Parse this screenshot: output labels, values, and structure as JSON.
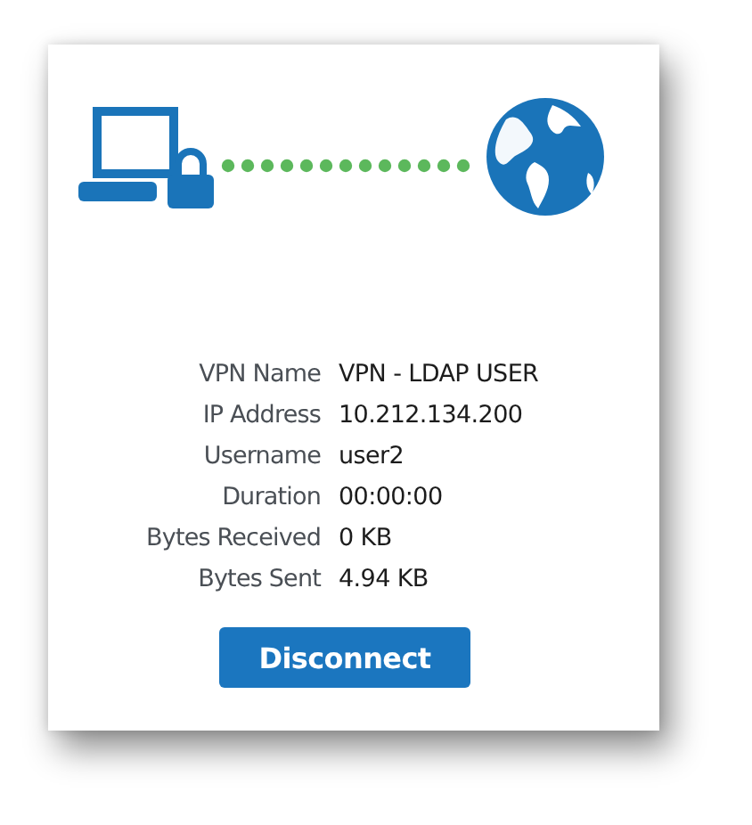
{
  "connection": {
    "details": [
      {
        "label": "VPN Name",
        "value": "VPN - LDAP USER"
      },
      {
        "label": "IP Address",
        "value": "10.212.134.200"
      },
      {
        "label": "Username",
        "value": "user2"
      },
      {
        "label": "Duration",
        "value": "00:00:00"
      },
      {
        "label": "Bytes Received",
        "value": "0 KB"
      },
      {
        "label": "Bytes Sent",
        "value": "4.94 KB"
      }
    ],
    "button": "Disconnect"
  }
}
